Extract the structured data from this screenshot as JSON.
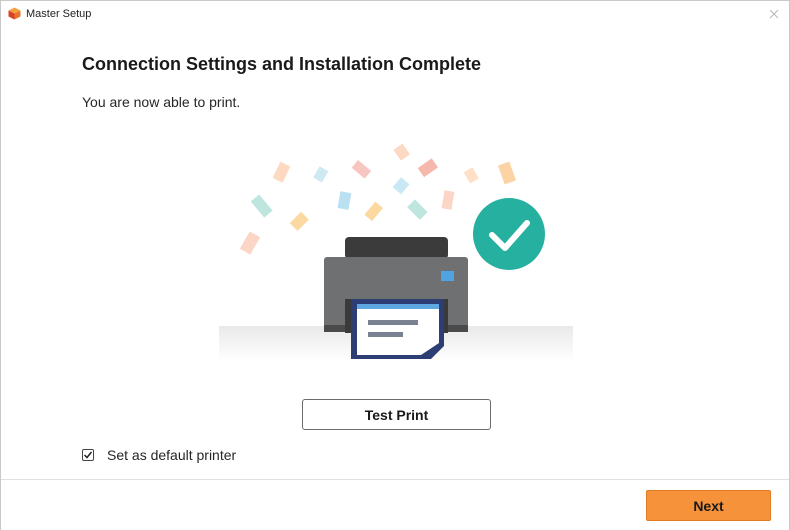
{
  "window": {
    "title": "Master Setup",
    "app_icon": "master-setup-icon",
    "close_icon": "close-icon"
  },
  "main": {
    "heading": "Connection Settings and Installation Complete",
    "subtext": "You are now able to print.",
    "illustration_icons": [
      "printer-icon",
      "check-circle-icon",
      "confetti"
    ]
  },
  "actions": {
    "test_print_label": "Test Print",
    "default_printer_label": "Set as default printer",
    "default_printer_checked": true
  },
  "footer": {
    "next_label": "Next"
  },
  "colors": {
    "accent": "#f6923a",
    "success": "#26b0a0"
  }
}
